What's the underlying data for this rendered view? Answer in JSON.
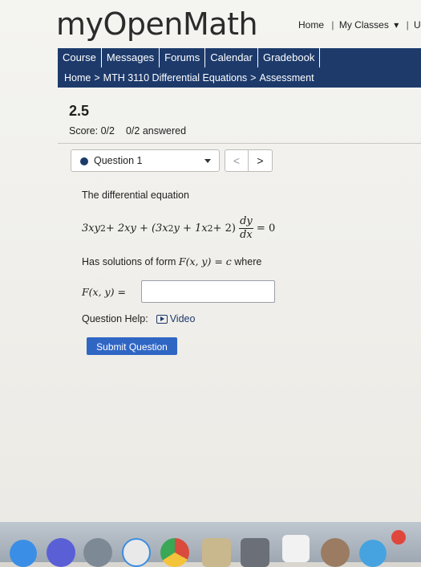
{
  "header": {
    "logo": "myOpenMath",
    "nav": {
      "home": "Home",
      "sep1": "|",
      "my_classes": "My Classes",
      "caret": "▾",
      "sep2": "|",
      "cut": "U"
    }
  },
  "navbar": {
    "items": [
      {
        "label": "Course"
      },
      {
        "label": "Messages"
      },
      {
        "label": "Forums"
      },
      {
        "label": "Calendar"
      },
      {
        "label": "Gradebook"
      }
    ],
    "breadcrumb": {
      "home": "Home",
      "sep": ">",
      "course": "MTH 3110 Differential Equations",
      "page": "Assessment"
    }
  },
  "assessment": {
    "title": "2.5",
    "score": "Score: 0/2",
    "answered": "0/2 answered"
  },
  "question_nav": {
    "selected": "Question 1",
    "prev": "<",
    "next": ">"
  },
  "question": {
    "prompt": "The differential equation",
    "eq": {
      "t1": "3xy",
      "e1": "2",
      "t2": " + 2xy + (3x",
      "e2": "2",
      "t3": "y + 1x",
      "e3": "2",
      "t4": " + 2)",
      "num": "dy",
      "den": "dx",
      "tail": " = 0"
    },
    "solutions_pre": "Has solutions of form ",
    "solutions_math": "F(x, y) = c",
    "solutions_post": " where",
    "field_label": "F(x, y) =",
    "field_value": "",
    "help_label": "Question Help:",
    "video_label": "Video",
    "submit_label": "Submit Question"
  },
  "colors": {
    "accent": "#1d3a6b",
    "button": "#2f66c4"
  }
}
